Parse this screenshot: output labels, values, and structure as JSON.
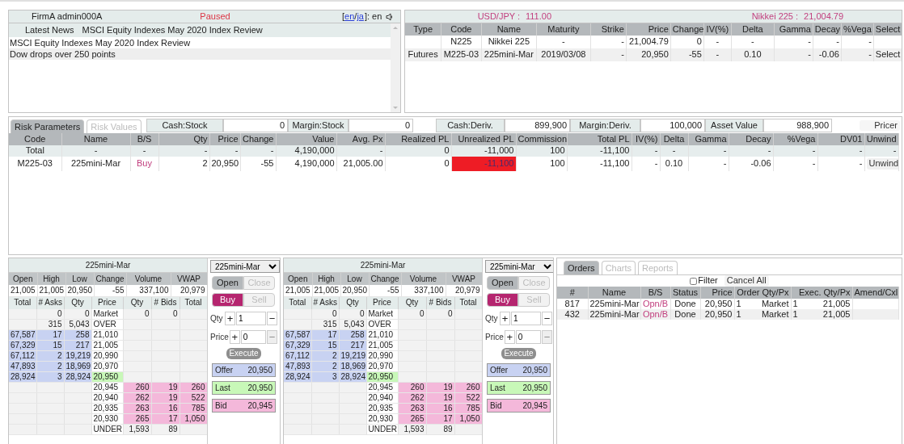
{
  "header": {
    "user": "FirmA admin000A",
    "status": "Paused",
    "lang_open": "[",
    "lang_links": [
      "en",
      "ja"
    ],
    "lang_sep": "/",
    "lang_suffix": "]: en"
  },
  "news": {
    "label": "Latest News",
    "headline": "MSCI Equity Indexes May 2020 Index Review",
    "items": [
      "MSCI Equity Indexes May 2020 Index Review",
      "Dow drops over 250 points"
    ]
  },
  "market": [
    {
      "label": "USD/JPY :",
      "value": "111.00"
    },
    {
      "label": "Nikkei 225 :",
      "value": "21,004.79"
    }
  ],
  "instruments": {
    "columns": [
      "Type",
      "Code",
      "Name",
      "Maturity",
      "Strike",
      "Price",
      "Change",
      "IV(%)",
      "Delta",
      "Gamma",
      "Decay",
      "%Vega",
      "Select"
    ],
    "rows": [
      {
        "cells": [
          null,
          "N225",
          "Nikkei 225",
          "-",
          "-",
          "21,004.79",
          "0",
          "-",
          "-",
          "-",
          "-",
          "-",
          null
        ]
      },
      {
        "cells": [
          "Futures",
          "M225-03",
          "225mini-Mar",
          "2019/03/08",
          "-",
          "20,950",
          "-55",
          "-",
          "0.10",
          "-",
          "-0.06",
          "-",
          "Select"
        ]
      }
    ]
  },
  "risk": {
    "tabs": [
      {
        "label": "Risk Parameters",
        "selected": true
      },
      {
        "label": "Risk Values",
        "selected": false
      }
    ],
    "fields": [
      {
        "label": "Cash:Stock",
        "value": "0"
      },
      {
        "label": "Margin:Stock",
        "value": "0"
      },
      {
        "label": "Cash:Deriv.",
        "value": "899,900"
      },
      {
        "label": "Margin:Deriv.",
        "value": "100,000"
      },
      {
        "label": "Asset Value",
        "value": "988,900"
      }
    ],
    "pricer": "Pricer",
    "columns": [
      "Code",
      "Name",
      "B/S",
      "Qty",
      "Price",
      "Change",
      "Value",
      "Avg. Px",
      "Realized PL",
      "Unrealized PL",
      "Commission",
      "Total PL",
      "IV(%)",
      "Delta",
      "Gamma",
      "Decay",
      "%Vega",
      "DV01",
      "Unwind"
    ],
    "rows": [
      {
        "kind": "total",
        "alert": false,
        "cells": [
          "Total",
          "-",
          "-",
          "-",
          "-",
          "-",
          "4,190,000",
          "-",
          "0",
          "-11,000",
          "100",
          "-11,100",
          "-",
          "-",
          "-",
          "-",
          "-",
          "-",
          "-"
        ]
      },
      {
        "kind": "position",
        "alert": true,
        "cells": [
          "M225-03",
          "225mini-Mar",
          "Buy",
          "2",
          "20,950",
          "-55",
          "4,190,000",
          "21,005.00",
          "0",
          "-11,100",
          "100",
          "-11,100",
          "-",
          "0.10",
          "-",
          "-0.06",
          "-",
          "-",
          "Unwind"
        ]
      }
    ]
  },
  "books": [
    {
      "title": "225mini-Mar",
      "stat_columns": [
        "Open",
        "High",
        "Low",
        "Change",
        "Volume",
        "VWAP"
      ],
      "stat_values": [
        "21,005",
        "21,005",
        "20,950",
        "-55",
        "337,100",
        "20,979"
      ],
      "columns": [
        "Total",
        "# Asks",
        "Qty",
        "Price",
        "Qty",
        "# Bids",
        "Total"
      ],
      "rows": [
        {
          "kind": "plain",
          "last": false,
          "cells": [
            null,
            "0",
            "0",
            "Market",
            "0",
            "0",
            null
          ]
        },
        {
          "kind": "plain",
          "last": false,
          "cells": [
            null,
            "315",
            "5,043",
            "OVER",
            null,
            null,
            null
          ]
        },
        {
          "kind": "ask",
          "last": false,
          "cells": [
            "67,587",
            "17",
            "258",
            "21,010",
            null,
            null,
            null
          ]
        },
        {
          "kind": "ask",
          "last": false,
          "cells": [
            "67,329",
            "15",
            "217",
            "21,005",
            null,
            null,
            null
          ]
        },
        {
          "kind": "ask",
          "last": false,
          "cells": [
            "67,112",
            "2",
            "19,219",
            "20,990",
            null,
            null,
            null
          ]
        },
        {
          "kind": "ask",
          "last": false,
          "cells": [
            "47,893",
            "2",
            "18,969",
            "20,970",
            null,
            null,
            null
          ]
        },
        {
          "kind": "ask",
          "last": true,
          "cells": [
            "28,924",
            "3",
            "28,924",
            "20,950",
            null,
            null,
            null
          ]
        },
        {
          "kind": "bid",
          "last": false,
          "cells": [
            null,
            null,
            null,
            "20,945",
            "260",
            "19",
            "260"
          ]
        },
        {
          "kind": "bid",
          "last": false,
          "cells": [
            null,
            null,
            null,
            "20,940",
            "262",
            "19",
            "522"
          ]
        },
        {
          "kind": "bid",
          "last": false,
          "cells": [
            null,
            null,
            null,
            "20,935",
            "263",
            "16",
            "785"
          ]
        },
        {
          "kind": "bid",
          "last": false,
          "cells": [
            null,
            null,
            null,
            "20,930",
            "265",
            "17",
            "1,050"
          ]
        },
        {
          "kind": "plain",
          "last": false,
          "cells": [
            null,
            null,
            null,
            "UNDER",
            "1,593",
            "89",
            null
          ]
        }
      ],
      "ticket": {
        "instrument": "225mini-Mar",
        "modes": [
          {
            "label": "Open",
            "selected": true
          },
          {
            "label": "Close",
            "selected": false
          }
        ],
        "sides": [
          {
            "label": "Buy",
            "selected": true
          },
          {
            "label": "Sell",
            "selected": false
          }
        ],
        "inputs": [
          {
            "label": "Qty",
            "plus": "+",
            "value": "1",
            "minus": "−",
            "minus_disabled": false
          },
          {
            "label": "Price",
            "plus": "+",
            "value": "0",
            "minus": "−",
            "minus_disabled": true
          }
        ],
        "execute": {
          "label": "Execute",
          "disabled": true
        },
        "quotes": [
          {
            "kind": "offer",
            "label": "Offer",
            "value": "20,950"
          },
          {
            "kind": "last",
            "label": "Last",
            "value": "20,950"
          },
          {
            "kind": "bid",
            "label": "Bid",
            "value": "20,945"
          }
        ]
      }
    },
    {
      "title": "225mini-Mar",
      "stat_columns": [
        "Open",
        "High",
        "Low",
        "Change",
        "Volume",
        "VWAP"
      ],
      "stat_values": [
        "21,005",
        "21,005",
        "20,950",
        "-55",
        "337,100",
        "20,979"
      ],
      "columns": [
        "Total",
        "# Asks",
        "Qty",
        "Price",
        "Qty",
        "# Bids",
        "Total"
      ],
      "rows": [
        {
          "kind": "plain",
          "last": false,
          "cells": [
            null,
            "0",
            "0",
            "Market",
            "0",
            "0",
            null
          ]
        },
        {
          "kind": "plain",
          "last": false,
          "cells": [
            null,
            "315",
            "5,043",
            "OVER",
            null,
            null,
            null
          ]
        },
        {
          "kind": "ask",
          "last": false,
          "cells": [
            "67,587",
            "17",
            "258",
            "21,010",
            null,
            null,
            null
          ]
        },
        {
          "kind": "ask",
          "last": false,
          "cells": [
            "67,329",
            "15",
            "217",
            "21,005",
            null,
            null,
            null
          ]
        },
        {
          "kind": "ask",
          "last": false,
          "cells": [
            "67,112",
            "2",
            "19,219",
            "20,990",
            null,
            null,
            null
          ]
        },
        {
          "kind": "ask",
          "last": false,
          "cells": [
            "47,893",
            "2",
            "18,969",
            "20,970",
            null,
            null,
            null
          ]
        },
        {
          "kind": "ask",
          "last": true,
          "cells": [
            "28,924",
            "3",
            "28,924",
            "20,950",
            null,
            null,
            null
          ]
        },
        {
          "kind": "bid",
          "last": false,
          "cells": [
            null,
            null,
            null,
            "20,945",
            "260",
            "19",
            "260"
          ]
        },
        {
          "kind": "bid",
          "last": false,
          "cells": [
            null,
            null,
            null,
            "20,940",
            "262",
            "19",
            "522"
          ]
        },
        {
          "kind": "bid",
          "last": false,
          "cells": [
            null,
            null,
            null,
            "20,935",
            "263",
            "16",
            "785"
          ]
        },
        {
          "kind": "bid",
          "last": false,
          "cells": [
            null,
            null,
            null,
            "20,930",
            "265",
            "17",
            "1,050"
          ]
        },
        {
          "kind": "plain",
          "last": false,
          "cells": [
            null,
            null,
            null,
            "UNDER",
            "1,593",
            "89",
            null
          ]
        }
      ],
      "ticket": {
        "instrument": "225mini-Mar",
        "modes": [
          {
            "label": "Open",
            "selected": true
          },
          {
            "label": "Close",
            "selected": false
          }
        ],
        "sides": [
          {
            "label": "Buy",
            "selected": true
          },
          {
            "label": "Sell",
            "selected": false
          }
        ],
        "inputs": [
          {
            "label": "Qty",
            "plus": "+",
            "value": "1",
            "minus": "−",
            "minus_disabled": false
          },
          {
            "label": "Price",
            "plus": "+",
            "value": "0",
            "minus": "−",
            "minus_disabled": true
          }
        ],
        "execute": {
          "label": "Execute",
          "disabled": true
        },
        "quotes": [
          {
            "kind": "offer",
            "label": "Offer",
            "value": "20,950"
          },
          {
            "kind": "last",
            "label": "Last",
            "value": "20,950"
          },
          {
            "kind": "bid",
            "label": "Bid",
            "value": "20,945"
          }
        ]
      }
    }
  ],
  "orders": {
    "tabs": [
      {
        "label": "Orders",
        "selected": true
      },
      {
        "label": "Charts",
        "selected": false
      },
      {
        "label": "Reports",
        "selected": false
      }
    ],
    "filter": {
      "label": "Filter",
      "checked": false
    },
    "cancel_all": "Cancel All",
    "columns": [
      "#",
      "Name",
      "B/S",
      "Status",
      "Price",
      "Order Qty/Px",
      "Exec. Qty/Px",
      "Amend/Cxl"
    ],
    "rows": [
      {
        "cells": [
          "817",
          "225mini-Mar",
          "Opn/B",
          "Done",
          "20,950",
          {
            "qty": "1",
            "px": "Market"
          },
          {
            "qty": "1",
            "px": "21,005"
          },
          null
        ]
      },
      {
        "cells": [
          "432",
          "225mini-Mar",
          "Opn/B",
          "Done",
          "20,950",
          {
            "qty": "1",
            "px": "Market"
          },
          {
            "qty": "1",
            "px": "21,005"
          },
          null
        ]
      }
    ]
  }
}
